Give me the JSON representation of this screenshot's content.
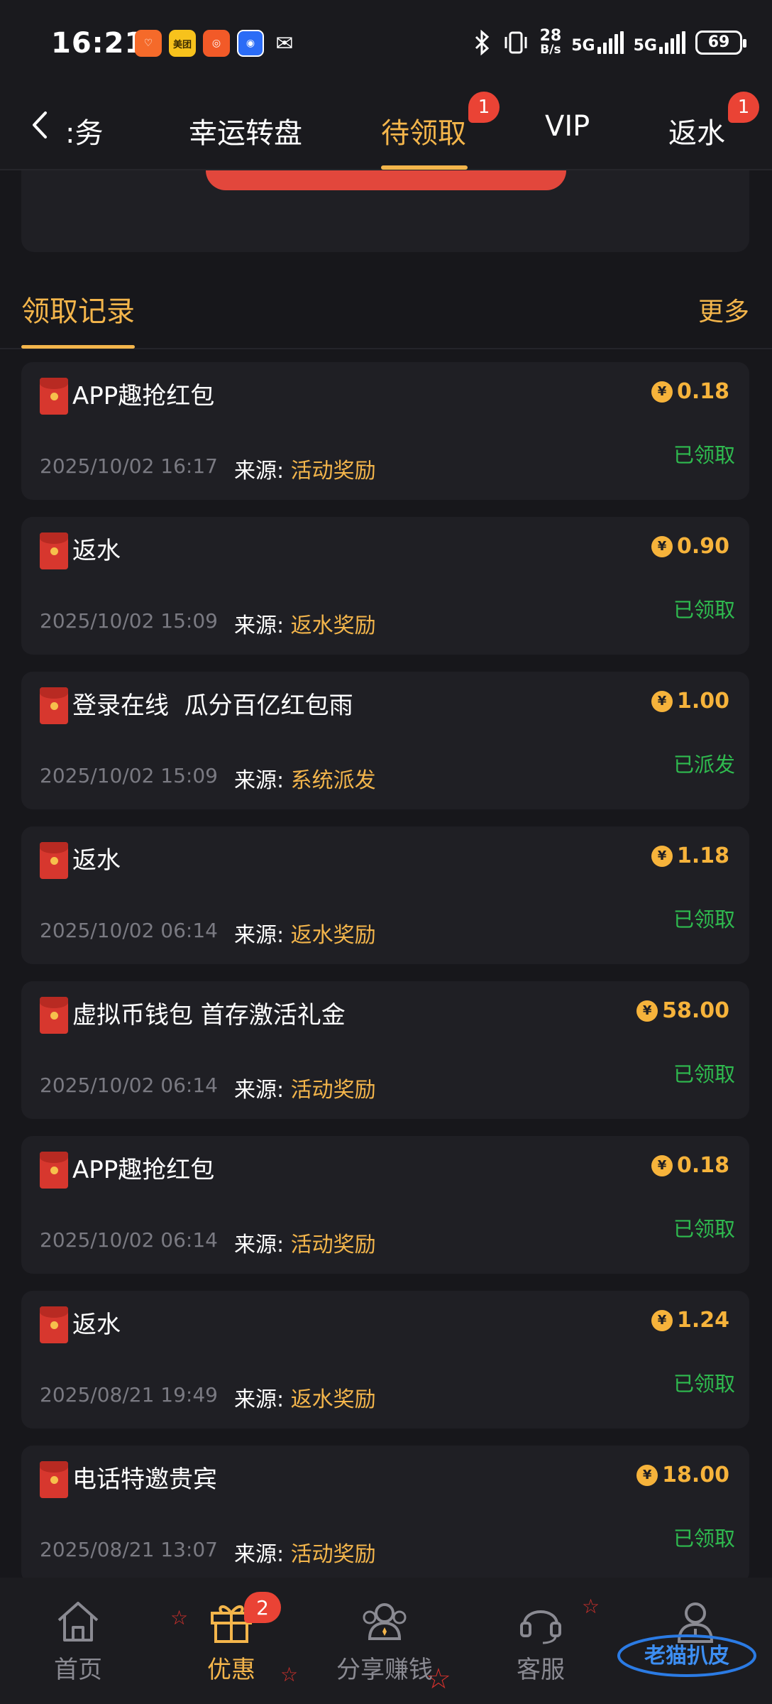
{
  "status_bar": {
    "time": "16:21",
    "apps": [
      {
        "icon": "taobao-icon",
        "color": "#f56a2a",
        "glyph": "♡"
      },
      {
        "icon": "meituan-icon",
        "color": "#f7c21c",
        "glyph": "美团"
      },
      {
        "icon": "kuaishou-icon",
        "color": "#f25a28",
        "glyph": "◎"
      },
      {
        "icon": "blue-app-icon",
        "color": "#2b6cf6",
        "glyph": "◉"
      },
      {
        "icon": "wechat-icon",
        "color": "#1a1a1e",
        "glyph": "✉"
      }
    ],
    "net_speed_top": "28",
    "net_speed_bottom": "B/s",
    "signal1": "5G",
    "signal2": "5G",
    "battery": "69"
  },
  "tabs": [
    {
      "label": ":务",
      "active": false
    },
    {
      "label": "幸运转盘",
      "active": false
    },
    {
      "label": "待领取",
      "active": true,
      "badge": "1"
    },
    {
      "label": "VIP",
      "active": false
    },
    {
      "label": "返水",
      "active": false,
      "badge": "1"
    }
  ],
  "records": {
    "title": "领取记录",
    "more": "更多",
    "source_prefix": "来源:",
    "items": [
      {
        "title": "APP趣抢红包",
        "amount": "0.18",
        "status": "已领取",
        "date": "2025/10/02 16:17",
        "source": "活动奖励"
      },
      {
        "title": "返水",
        "amount": "0.90",
        "status": "已领取",
        "date": "2025/10/02 15:09",
        "source": "返水奖励"
      },
      {
        "title": "登录在线  瓜分百亿红包雨",
        "amount": "1.00",
        "status": "已派发",
        "date": "2025/10/02 15:09",
        "source": "系统派发"
      },
      {
        "title": "返水",
        "amount": "1.18",
        "status": "已领取",
        "date": "2025/10/02 06:14",
        "source": "返水奖励"
      },
      {
        "title": "虚拟币钱包 首存激活礼金",
        "amount": "58.00",
        "status": "已领取",
        "date": "2025/10/02 06:14",
        "source": "活动奖励"
      },
      {
        "title": "APP趣抢红包",
        "amount": "0.18",
        "status": "已领取",
        "date": "2025/10/02 06:14",
        "source": "活动奖励"
      },
      {
        "title": "返水",
        "amount": "1.24",
        "status": "已领取",
        "date": "2025/08/21 19:49",
        "source": "返水奖励"
      },
      {
        "title": "电话特邀贵宾",
        "amount": "18.00",
        "status": "已领取",
        "date": "2025/08/21 13:07",
        "source": "活动奖励"
      }
    ]
  },
  "bottom_nav": [
    {
      "label": "首页",
      "icon": "home-icon",
      "active": false
    },
    {
      "label": "优惠",
      "icon": "gift-icon",
      "active": true,
      "badge": "2"
    },
    {
      "label": "分享赚钱",
      "icon": "share-users-icon",
      "active": false
    },
    {
      "label": "客服",
      "icon": "headset-icon",
      "active": false
    },
    {
      "label": "",
      "icon": "profile-icon",
      "active": false
    }
  ],
  "watermark": "老猫扒皮"
}
